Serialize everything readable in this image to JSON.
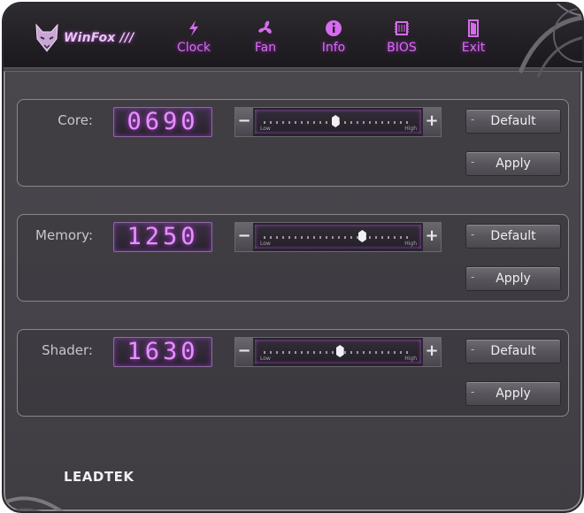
{
  "app": {
    "logo_text": "WinFox ///",
    "brand_text": "LEADTEK"
  },
  "nav": [
    {
      "label": "Clock",
      "icon": "lightning-icon"
    },
    {
      "label": "Fan",
      "icon": "fan-icon"
    },
    {
      "label": "Info",
      "icon": "info-icon"
    },
    {
      "label": "BIOS",
      "icon": "chip-icon"
    },
    {
      "label": "Exit",
      "icon": "door-icon"
    }
  ],
  "rows": [
    {
      "label": "Core:",
      "value": "0690",
      "slider_low": "Low",
      "slider_high": "High",
      "slider_fraction": 0.48,
      "default_label": "Default",
      "apply_label": "Apply"
    },
    {
      "label": "Memory:",
      "value": "1250",
      "slider_low": "Low",
      "slider_high": "High",
      "slider_fraction": 0.66,
      "default_label": "Default",
      "apply_label": "Apply"
    },
    {
      "label": "Shader:",
      "value": "1630",
      "slider_low": "Low",
      "slider_high": "High",
      "slider_fraction": 0.51,
      "default_label": "Default",
      "apply_label": "Apply"
    }
  ],
  "colors": {
    "accent": "#d76bf0",
    "lcd_text": "#e890ff",
    "background": "#46434a"
  }
}
